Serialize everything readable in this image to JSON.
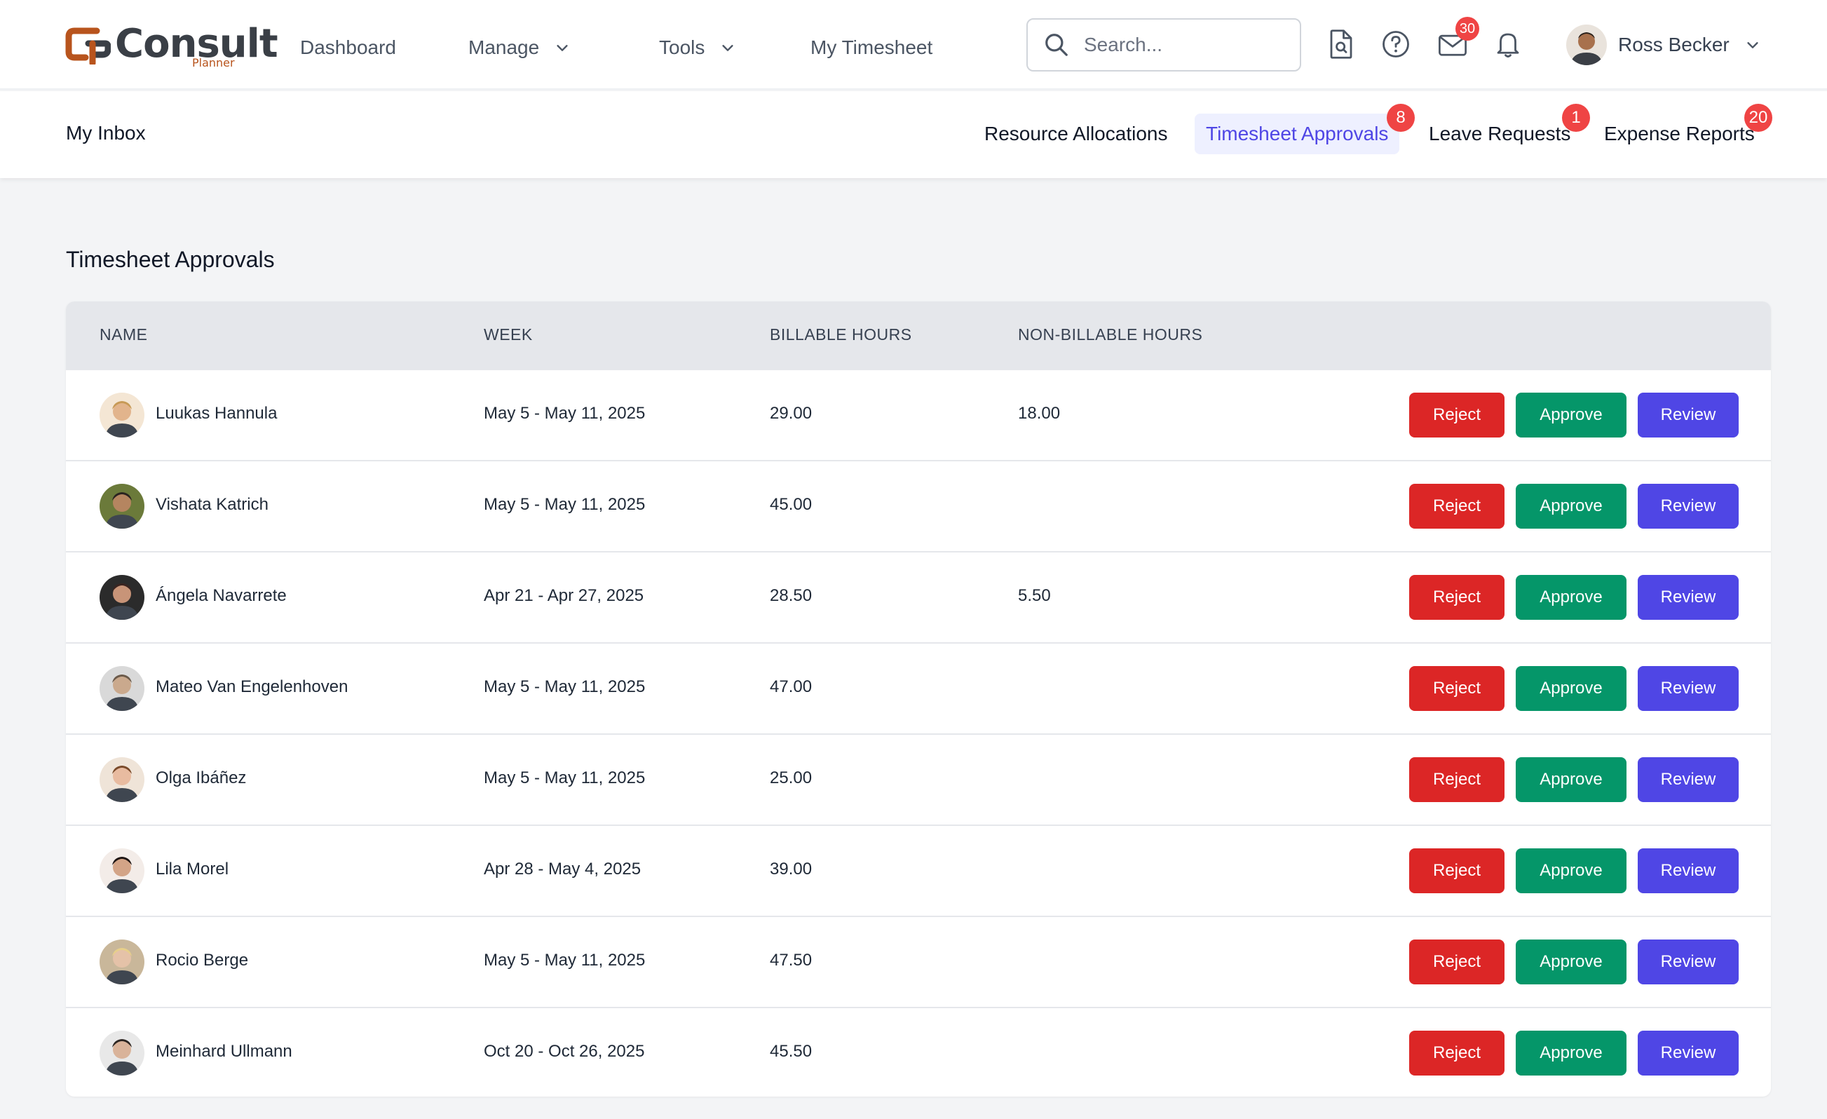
{
  "app": {
    "logo_text": "Consult",
    "logo_sub": "Planner"
  },
  "nav": {
    "dashboard": "Dashboard",
    "manage": "Manage",
    "tools": "Tools",
    "my_timesheet": "My Timesheet"
  },
  "search": {
    "placeholder": "Search..."
  },
  "header_icons": {
    "document": "document-search-icon",
    "help": "help-circle-icon",
    "mail": "mail-icon",
    "mail_badge": "30",
    "bell": "bell-icon"
  },
  "user": {
    "name": "Ross Becker"
  },
  "inbox": {
    "title": "My Inbox",
    "tabs": [
      {
        "label": "Resource Allocations",
        "badge": ""
      },
      {
        "label": "Timesheet Approvals",
        "badge": "8",
        "active": true
      },
      {
        "label": "Leave Requests",
        "badge": "1"
      },
      {
        "label": "Expense Reports",
        "badge": "20"
      }
    ]
  },
  "main": {
    "title": "Timesheet Approvals",
    "columns": [
      "NAME",
      "WEEK",
      "BILLABLE HOURS",
      "NON-BILLABLE HOURS"
    ],
    "actions": {
      "reject": "Reject",
      "approve": "Approve",
      "review": "Review"
    },
    "rows": [
      {
        "name": "Luukas Hannula",
        "week": "May 5 - May 11, 2025",
        "billable": "29.00",
        "non_billable": "18.00"
      },
      {
        "name": "Vishata Katrich",
        "week": "May 5 - May 11, 2025",
        "billable": "45.00",
        "non_billable": ""
      },
      {
        "name": "Ángela Navarrete",
        "week": "Apr 21 - Apr 27, 2025",
        "billable": "28.50",
        "non_billable": "5.50"
      },
      {
        "name": "Mateo Van Engelenhoven",
        "week": "May 5 - May 11, 2025",
        "billable": "47.00",
        "non_billable": ""
      },
      {
        "name": "Olga Ibáñez",
        "week": "May 5 - May 11, 2025",
        "billable": "25.00",
        "non_billable": ""
      },
      {
        "name": "Lila Morel",
        "week": "Apr 28 - May 4, 2025",
        "billable": "39.00",
        "non_billable": ""
      },
      {
        "name": "Rocio Berge",
        "week": "May 5 - May 11, 2025",
        "billable": "47.50",
        "non_billable": ""
      },
      {
        "name": "Meinhard Ullmann",
        "week": "Oct 20 - Oct 26, 2025",
        "billable": "45.50",
        "non_billable": ""
      }
    ]
  },
  "colors": {
    "accent": "#4f46e5",
    "reject": "#dc2626",
    "approve": "#059669",
    "badge": "#ef4444",
    "brand": "#b8541d"
  }
}
